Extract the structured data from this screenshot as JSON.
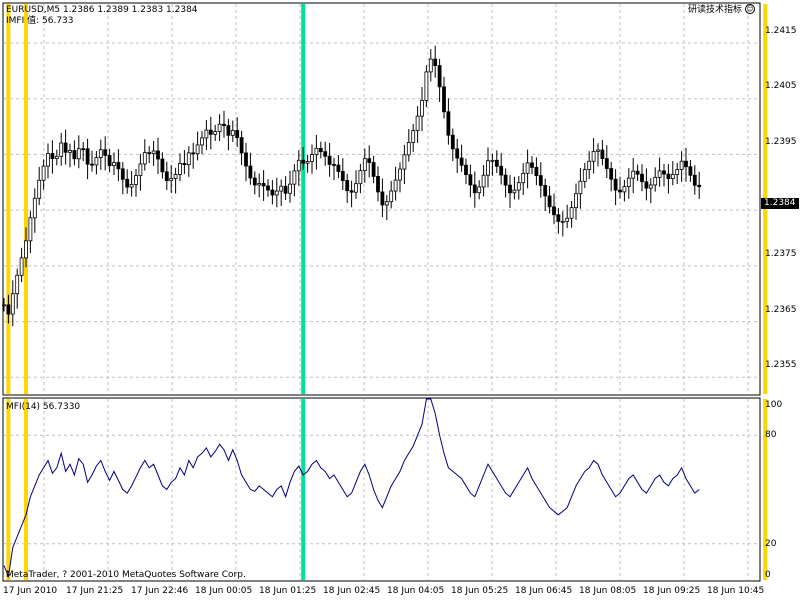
{
  "main_chart": {
    "title": "EURUSD,M5  1.2386 1.2389 1.2383 1.2384",
    "indicator_label": "IMFI 值:  56.733",
    "corner_label": "研读技术指标",
    "current_price": "1.2384",
    "y_ticks": [
      "1.2415",
      "1.2405",
      "1.2395",
      "1.2375",
      "1.2365",
      "1.2355"
    ]
  },
  "sub_chart": {
    "label": "MFI(14) 56.7330",
    "y_ticks": [
      "100",
      "80",
      "20",
      "0"
    ],
    "copyright": "MetaTrader, ? 2001-2010 MetaQuotes Software Corp."
  },
  "x_ticks": [
    "17 Jun 2010",
    "17 Jun 21:25",
    "17 Jun 22:46",
    "18 Jun 00:05",
    "18 Jun 01:25",
    "18 Jun 02:45",
    "18 Jun 04:05",
    "18 Jun 05:25",
    "18 Jun 06:45",
    "18 Jun 08:05",
    "18 Jun 09:25",
    "18 Jun 10:45"
  ],
  "colors": {
    "signal_yellow": "#FFD700",
    "signal_green": "#00E09A",
    "mfi_line": "#000080",
    "grid": "#C0C0C0",
    "candle": "#000000"
  },
  "chart_data": {
    "type": "line",
    "price_range": [
      1.2352,
      1.2422
    ],
    "mfi_range": [
      0,
      100
    ],
    "mfi_values": [
      8,
      2,
      18,
      24,
      30,
      36,
      46,
      52,
      58,
      62,
      66,
      59,
      62,
      70,
      60,
      64,
      58,
      67,
      64,
      54,
      58,
      63,
      66,
      60,
      55,
      60,
      55,
      50,
      48,
      52,
      57,
      62,
      66,
      62,
      64,
      58,
      52,
      50,
      54,
      56,
      62,
      58,
      66,
      62,
      68,
      70,
      73,
      68,
      71,
      75,
      72,
      66,
      72,
      66,
      58,
      54,
      50,
      49,
      52,
      50,
      48,
      46,
      50,
      52,
      46,
      54,
      60,
      63,
      58,
      60,
      64,
      66,
      62,
      60,
      56,
      58,
      54,
      50,
      46,
      48,
      54,
      60,
      64,
      58,
      50,
      44,
      40,
      46,
      52,
      56,
      60,
      66,
      70,
      74,
      80,
      86,
      100,
      100,
      92,
      80,
      70,
      62,
      60,
      58,
      56,
      52,
      48,
      46,
      52,
      58,
      64,
      60,
      56,
      52,
      48,
      46,
      50,
      54,
      58,
      62,
      56,
      52,
      48,
      44,
      40,
      38,
      36,
      38,
      40,
      46,
      52,
      56,
      60,
      62,
      66,
      64,
      58,
      54,
      50,
      46,
      48,
      52,
      56,
      58,
      54,
      50,
      48,
      52,
      56,
      58,
      54,
      52,
      56,
      58,
      62,
      56,
      52,
      48,
      50
    ],
    "signal_lines": [
      {
        "color": "yellow",
        "index": 1
      },
      {
        "color": "yellow",
        "index": 5
      },
      {
        "color": "green",
        "index": 68
      },
      {
        "color": "yellow",
        "index": 173
      }
    ]
  }
}
